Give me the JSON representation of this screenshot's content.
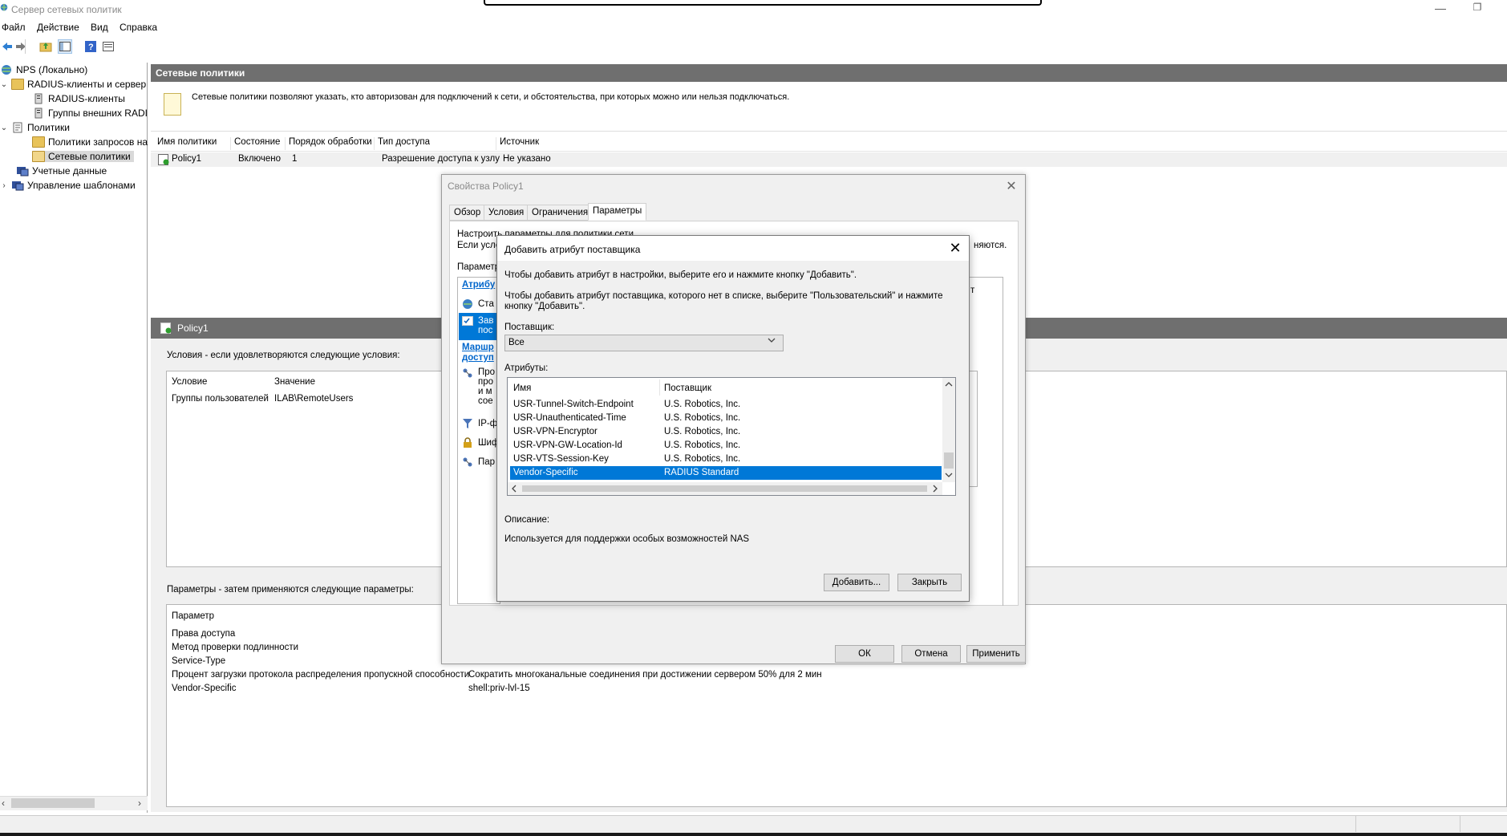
{
  "window": {
    "title": "Сервер сетевых политик",
    "minimize_glyph": "—",
    "restore_glyph": "❐"
  },
  "menu": [
    "Файл",
    "Действие",
    "Вид",
    "Справка"
  ],
  "toolbar": {
    "icons": [
      "back-arrow-icon",
      "forward-arrow-icon",
      "up-folder-icon",
      "show-hide-tree-icon",
      "help-icon",
      "properties-icon"
    ]
  },
  "tree": {
    "items": [
      {
        "label": "NPS (Локально)",
        "icon": "nps-globe-icon"
      },
      {
        "label": "RADIUS-клиенты и сервер",
        "icon": "folder-icon",
        "expander": "⌄"
      },
      {
        "label": "RADIUS-клиенты",
        "icon": "server-icon"
      },
      {
        "label": "Группы внешних RADI",
        "icon": "server-icon"
      },
      {
        "label": "Политики",
        "icon": "policy-icon",
        "expander": "⌄"
      },
      {
        "label": "Политики запросов на",
        "icon": "folder-icon"
      },
      {
        "label": "Сетевые политики",
        "icon": "folder-open-icon"
      },
      {
        "label": "Учетные данные",
        "icon": "accounting-icon"
      },
      {
        "label": "Управление шаблонами",
        "icon": "templates-icon",
        "expander": "›"
      }
    ],
    "scroll_left": "‹",
    "scroll_right": "›"
  },
  "main": {
    "header": "Сетевые политики",
    "info": "Сетевые политики позволяют указать, кто авторизован для подключений к сети, и обстоятельства, при которых можно или нельзя подключаться.",
    "columns": [
      "Имя политики",
      "Состояние",
      "Порядок обработки",
      "Тип доступа",
      "Источник"
    ],
    "rows": [
      {
        "name": "Policy1",
        "state": "Включено",
        "order": "1",
        "access": "Разрешение доступа к узлу",
        "source": "Не указано"
      }
    ]
  },
  "details": {
    "header": "Policy1",
    "conditions_label": "Условия - если удовлетворяются следующие условия:",
    "cond_columns": [
      "Условие",
      "Значение"
    ],
    "conditions": [
      {
        "condition": "Группы пользователей",
        "value": "ILAB\\RemoteUsers"
      }
    ],
    "settings_label": "Параметры - затем применяются следующие параметры:",
    "settings_column": "Параметр",
    "settings": [
      {
        "param": "Права доступа",
        "value": ""
      },
      {
        "param": "Метод проверки подлинности",
        "value": ""
      },
      {
        "param": "Service-Type",
        "value": ""
      },
      {
        "param": "Процент загрузки протокола распределения пропускной способности",
        "value": "Сократить многоканальные соединения при достижении сервером 50% для 2 мин"
      },
      {
        "param": "Vendor-Specific",
        "value": "shell:priv-lvl-15"
      }
    ]
  },
  "props_dialog": {
    "title": "Свойства Policy1",
    "close_glyph": "✕",
    "tabs": [
      "Обзор",
      "Условия",
      "Ограничения",
      "Параметры"
    ],
    "active_tab": "Параметры",
    "line1": "Настроить параметры для политики сети.",
    "line2": "Если усло",
    "line2_right": "няются.",
    "params_label": "Параметр",
    "left_nav": {
      "attributes_header": "Атрибу",
      "items": [
        {
          "text": "Ста",
          "icon": "globe-icon"
        },
        {
          "text": "Зав\nпос",
          "icon": "check-list-icon",
          "selected": true
        }
      ],
      "routing_header": "Маршр\nдоступ",
      "items2": [
        {
          "text": "Про\nпро\nи м\nсое",
          "icon": "network-icon"
        },
        {
          "text": "IP-ф",
          "icon": "filter-icon"
        },
        {
          "text": "Шиф",
          "icon": "lock-icon"
        },
        {
          "text": "Пар",
          "icon": "network-icon"
        }
      ]
    },
    "right_fragment": "т",
    "ok": "ОК",
    "cancel": "Отмена",
    "apply": "Применить"
  },
  "vendor_dialog": {
    "title": "Добавить атрибут поставщика",
    "close_glyph": "✕",
    "instr1": "Чтобы добавить атрибут в настройки, выберите его и нажмите кнопку \"Добавить\".",
    "instr2a": "Чтобы добавить атрибут поставщика, которого нет в списке, выберите \"Пользовательский\" и нажмите",
    "instr2b": "кнопку \"Добавить\".",
    "vendor_label": "Поставщик:",
    "vendor_value": "Все",
    "attributes_label": "Атрибуты:",
    "columns": [
      "Имя",
      "Поставщик"
    ],
    "attributes": [
      {
        "name": "USR-Tunnel-Switch-Endpoint",
        "vendor": "U.S. Robotics, Inc."
      },
      {
        "name": "USR-Unauthenticated-Time",
        "vendor": "U.S. Robotics, Inc."
      },
      {
        "name": "USR-VPN-Encryptor",
        "vendor": "U.S. Robotics, Inc."
      },
      {
        "name": "USR-VPN-GW-Location-Id",
        "vendor": "U.S. Robotics, Inc."
      },
      {
        "name": "USR-VTS-Session-Key",
        "vendor": "U.S. Robotics, Inc."
      },
      {
        "name": "Vendor-Specific",
        "vendor": "RADIUS Standard",
        "selected": true
      }
    ],
    "description_label": "Описание:",
    "description": "Используется для поддержки особых возможностей NAS",
    "add": "Добавить...",
    "close": "Закрыть"
  },
  "colors": {
    "selection": "#0078d7",
    "header_gray": "#6f6f6f",
    "link_blue": "#0066cc"
  }
}
